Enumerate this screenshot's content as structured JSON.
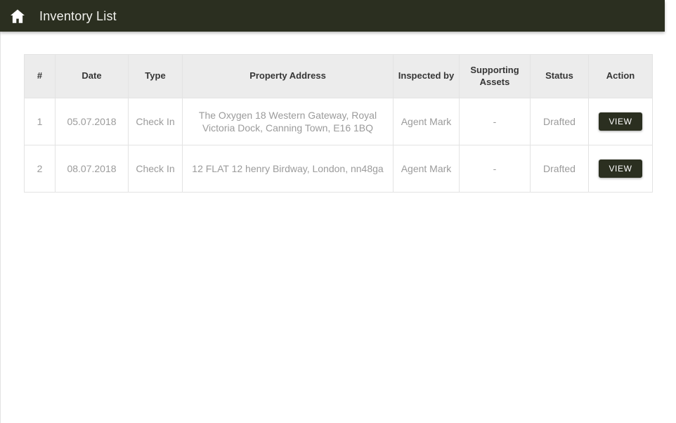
{
  "app_bar": {
    "home_icon": "home-icon",
    "title": "Inventory List",
    "background_color": "#2b2f20",
    "title_color": "#f2f2ee"
  },
  "table": {
    "columns": [
      {
        "key": "index",
        "label": "#"
      },
      {
        "key": "date",
        "label": "Date"
      },
      {
        "key": "type",
        "label": "Type"
      },
      {
        "key": "address",
        "label": "Property Address"
      },
      {
        "key": "inspected_by",
        "label": "Inspected by"
      },
      {
        "key": "supporting_assets",
        "label": "Supporting Assets"
      },
      {
        "key": "status",
        "label": "Status"
      },
      {
        "key": "action",
        "label": "Action"
      }
    ],
    "rows": [
      {
        "index": "1",
        "date": "05.07.2018",
        "type": "Check In",
        "address": "The Oxygen 18 Western Gateway, Royal Victoria Dock, Canning Town, E16 1BQ",
        "inspected_by": "Agent Mark",
        "supporting_assets": "-",
        "status": "Drafted",
        "action_label": "VIEW"
      },
      {
        "index": "2",
        "date": "08.07.2018",
        "type": "Check In",
        "address": "12 FLAT 12 henry Birdway, London, nn48ga",
        "inspected_by": "Agent Mark",
        "supporting_assets": "-",
        "status": "Drafted",
        "action_label": "VIEW"
      }
    ],
    "header_background": "#ececec",
    "header_text_color": "#363636",
    "row_text_color": "#9b9b9b",
    "button_color": "#2b2f20"
  }
}
